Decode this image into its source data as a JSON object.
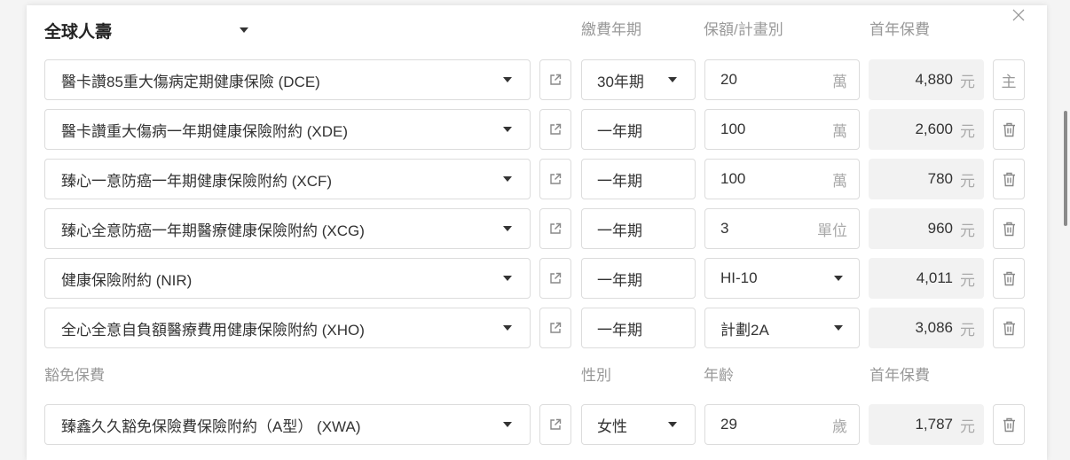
{
  "header": {
    "company": "全球人壽",
    "col_period": "繳費年期",
    "col_amount": "保額/計畫別",
    "col_premium": "首年保費"
  },
  "rows": [
    {
      "plan": "醫卡讚85重大傷病定期健康保險 (DCE)",
      "period": "30年期",
      "amount": "20",
      "amount_unit": "萬",
      "premium": "4,880",
      "premium_unit": "元",
      "action_label": "主"
    },
    {
      "plan": "醫卡讚重大傷病一年期健康保險附約 (XDE)",
      "period": "一年期",
      "amount": "100",
      "amount_unit": "萬",
      "premium": "2,600",
      "premium_unit": "元"
    },
    {
      "plan": "臻心一意防癌一年期健康保險附約 (XCF)",
      "period": "一年期",
      "amount": "100",
      "amount_unit": "萬",
      "premium": "780",
      "premium_unit": "元"
    },
    {
      "plan": "臻心全意防癌一年期醫療健康保險附約 (XCG)",
      "period": "一年期",
      "amount": "3",
      "amount_unit": "單位",
      "premium": "960",
      "premium_unit": "元"
    },
    {
      "plan": "健康保險附約 (NIR)",
      "period": "一年期",
      "amount": "HI-10",
      "premium": "4,011",
      "premium_unit": "元"
    },
    {
      "plan": "全心全意自負額醫療費用健康保險附約 (XHO)",
      "period": "一年期",
      "amount": "計劃2A",
      "premium": "3,086",
      "premium_unit": "元"
    }
  ],
  "waiver": {
    "section_label": "豁免保費",
    "col_gender": "性別",
    "col_age": "年齡",
    "col_premium": "首年保費",
    "plan": "臻鑫久久豁免保險費保險附約（A型） (XWA)",
    "gender": "女性",
    "age": "29",
    "age_unit": "歲",
    "premium": "1,787",
    "premium_unit": "元"
  },
  "icons": {
    "close": "close-icon",
    "dropdown": "chevron-down-icon",
    "open_link": "external-link-icon",
    "delete": "trash-icon"
  },
  "colors": {
    "text": "#333333",
    "muted": "#999999",
    "border": "#dcdcdc",
    "readonly_bg": "#f2f2f2"
  }
}
